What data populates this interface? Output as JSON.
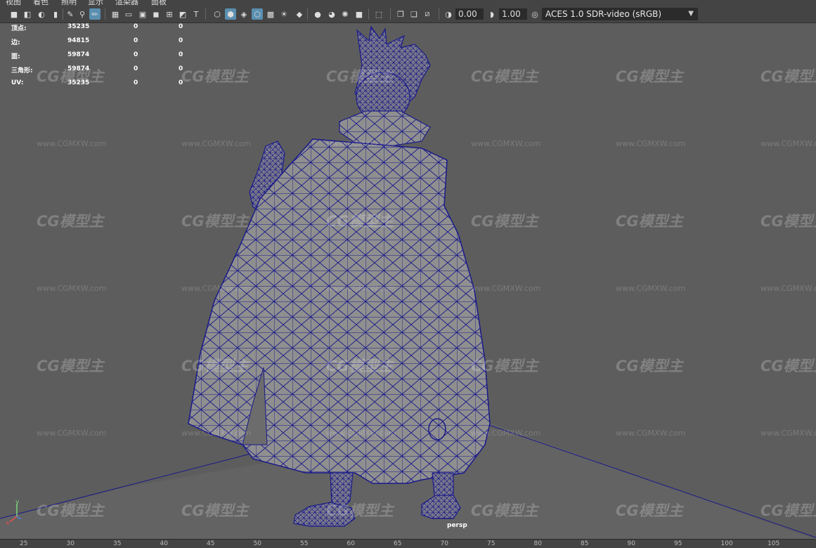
{
  "menu": [
    "视图",
    "着色",
    "照明",
    "显示",
    "渲染器",
    "面板"
  ],
  "toolbar": {
    "exposure_value": "0.00",
    "gamma_value": "1.00",
    "color_space": "ACES 1.0 SDR-video (sRGB)"
  },
  "hud": {
    "rows": [
      {
        "label": "顶点:",
        "v1": "35235",
        "v2": "0",
        "v3": "0"
      },
      {
        "label": "边:",
        "v1": "94815",
        "v2": "0",
        "v3": "0"
      },
      {
        "label": "面:",
        "v1": "59874",
        "v2": "0",
        "v3": "0"
      },
      {
        "label": "三角形:",
        "v1": "59874",
        "v2": "0",
        "v3": "0"
      },
      {
        "label": "UV:",
        "v1": "35235",
        "v2": "0",
        "v3": "0"
      }
    ]
  },
  "camera_label": "persp",
  "axis": {
    "y": "y",
    "x": "x"
  },
  "watermark": {
    "logo": "CG模型主",
    "url": "www.CGMXW.com"
  },
  "timeline_ticks": [
    "25",
    "30",
    "35",
    "40",
    "45",
    "50",
    "55",
    "60",
    "65",
    "70",
    "75",
    "80",
    "85",
    "90",
    "95",
    "100",
    "105"
  ],
  "colors": {
    "wire": "#1a1a8a",
    "viewport": "#5d5d5d",
    "accent": "#5a8fb0"
  }
}
